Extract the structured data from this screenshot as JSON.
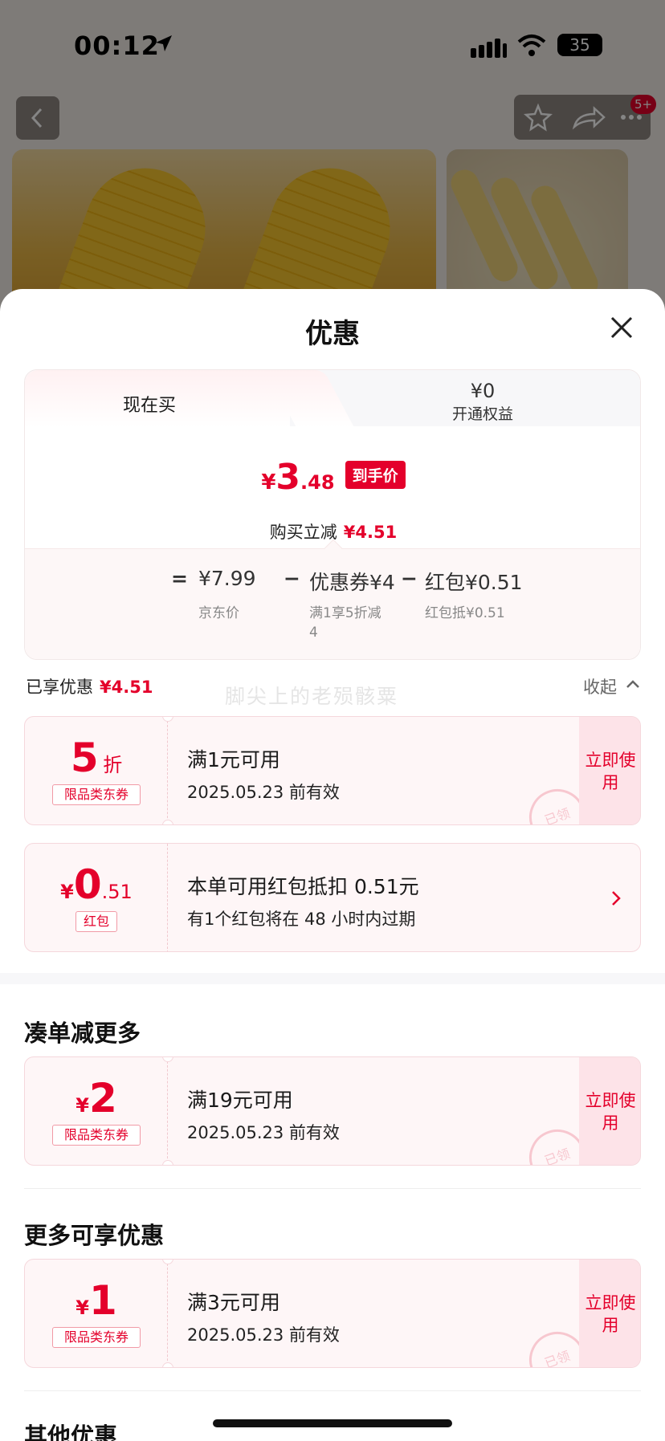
{
  "status_bar": {
    "time": "00:12",
    "battery": "35"
  },
  "background": {
    "badge": "5+"
  },
  "sheet": {
    "title": "优惠",
    "tabs": {
      "now": "现在买",
      "member_price": "¥0",
      "member_label": "开通权益"
    },
    "final_price": {
      "yen": "¥",
      "int": "3",
      "dec": ".48",
      "tag": "到手价"
    },
    "buy_reduce": {
      "label": "购买立减",
      "amount": "¥4.51"
    },
    "breakdown": {
      "eq": "=",
      "jd_price": "¥7.99",
      "minus1": "−",
      "coupon": "优惠券¥4",
      "minus2": "−",
      "redpacket": "红包¥0.51",
      "jd_price_label": "京东价",
      "coupon_label_1": "满1享5折减",
      "coupon_label_2": "4",
      "redpacket_label": "红包抵¥0.51"
    },
    "enjoyed": {
      "label": "已享优惠",
      "amount": "¥4.51"
    },
    "collapse": "收起",
    "watermark": "脚尖上的老殒骸粟",
    "coupons_enjoyed": [
      {
        "big": "5",
        "small": "折",
        "tag": "限品类东券",
        "title": "满1元可用",
        "sub": "2025.05.23 前有效",
        "use": "立即使用",
        "stamp": "已领"
      },
      {
        "yen": "¥",
        "big": "0",
        "small": ".51",
        "tag": "红包",
        "title": "本单可用红包抵扣 0.51元",
        "sub": "有1个红包将在 48 小时内过期"
      }
    ],
    "section_more": "凑单减更多",
    "coupon_more": {
      "yen": "¥",
      "big": "2",
      "tag": "限品类东券",
      "title": "满19元可用",
      "sub": "2025.05.23 前有效",
      "use": "立即使用",
      "stamp": "已领"
    },
    "section_other_enjoy": "更多可享优惠",
    "coupon_other": {
      "yen": "¥",
      "big": "1",
      "tag": "限品类东券",
      "title": "满3元可用",
      "sub": "2025.05.23 前有效",
      "use": "立即使用",
      "stamp": "已领"
    },
    "section_other": "其他优惠"
  }
}
